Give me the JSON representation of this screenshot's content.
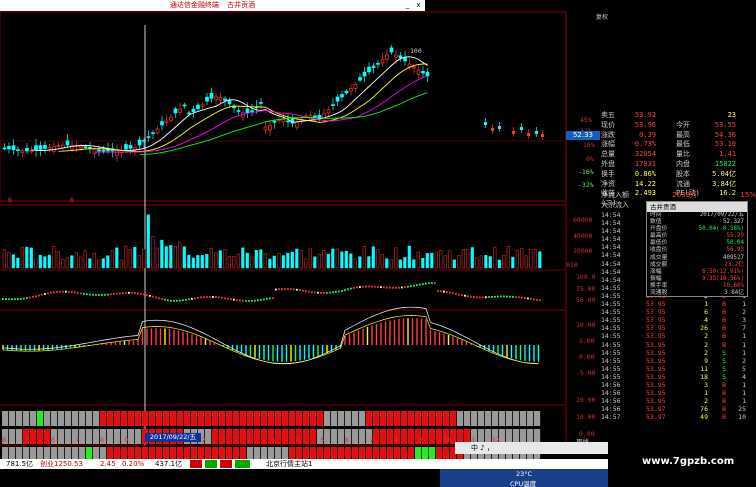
{
  "window": {
    "title_app": "通达信金融终端",
    "title_stock": "古井贡酒",
    "btn_min": "_",
    "btn_close": "x"
  },
  "tabs": {
    "label": " 复权"
  },
  "price_axis": {
    "labels": [
      "100",
      "45%",
      "32%",
      "16%",
      "0%",
      "-16%",
      "-32%"
    ],
    "price_tag": "52.33",
    "marks": [
      "B",
      "B"
    ]
  },
  "volume_axis": {
    "labels": [
      "60000",
      "40000",
      "20000",
      "X10"
    ]
  },
  "ind1_axis": {
    "labels": [
      "100.0",
      "75.00",
      "50.00"
    ]
  },
  "ind2_axis": {
    "labels": [
      "10.00",
      "5.00",
      "0.00",
      "-5.00"
    ]
  },
  "strip_axis": {
    "labels": [
      "20.00",
      "10.00",
      "0.00"
    ]
  },
  "date_axis": {
    "labels": [
      "8",
      "5",
      "6",
      "7",
      "8",
      "9",
      "10",
      "11",
      "12",
      "1",
      "2",
      "3",
      "4",
      "5",
      "6",
      "7",
      "8",
      "9",
      "10",
      "11",
      "12"
    ],
    "selected": "2017/09/22/五",
    "right_label": "周线"
  },
  "quote": {
    "header": "卖五",
    "rows": [
      [
        "现价",
        "53.96",
        "今开",
        "53.55"
      ],
      [
        "涨跌",
        "0.39",
        "最高",
        "54.36"
      ],
      [
        "涨幅",
        "0.73%",
        "最低",
        "53.10"
      ],
      [
        "总量",
        "32054",
        "量比",
        "1.41"
      ],
      [
        "外盘",
        "17831",
        "内盘",
        "15022"
      ],
      [
        "换手",
        "0.86%",
        "股本",
        "5.04亿"
      ],
      [
        "净资",
        "14.22",
        "流通",
        "3.84亿"
      ],
      [
        "收益(二)",
        "2.493",
        "PE(动)",
        "16.2"
      ]
    ],
    "sell5": {
      "price": "53.92",
      "vol": "23"
    }
  },
  "flow": {
    "label1": "净流入额",
    "value1": "2639万",
    "pct1": "15%",
    "label2": "大宗流入"
  },
  "ticks": [
    {
      "t": "14:54",
      "p": "53.95",
      "v": "1",
      "d": "B",
      "n": "2"
    },
    {
      "t": "14:54",
      "p": "53.95",
      "v": "4",
      "d": "B",
      "n": "1"
    },
    {
      "t": "14:54",
      "p": "53.95",
      "v": "1",
      "d": "B",
      "n": "1"
    },
    {
      "t": "14:54",
      "p": "53.95",
      "v": "1",
      "d": "B",
      "n": "1"
    },
    {
      "t": "14:54",
      "p": "53.95",
      "v": "2",
      "d": "B",
      "n": "1"
    },
    {
      "t": "14:54",
      "p": "53.95",
      "v": "1",
      "d": "B",
      "n": "1"
    },
    {
      "t": "14:54",
      "p": "53.95",
      "v": "2",
      "d": "B",
      "n": "1"
    },
    {
      "t": "14:54",
      "p": "53.95",
      "v": "1",
      "d": "B",
      "n": "1"
    },
    {
      "t": "14:54",
      "p": "53.95",
      "v": "3",
      "d": "B",
      "n": "1"
    },
    {
      "t": "14:55",
      "p": "53.95",
      "v": "1",
      "d": "B",
      "n": "1"
    },
    {
      "t": "14:55",
      "p": "53.95",
      "v": "2",
      "d": "B",
      "n": "1"
    },
    {
      "t": "14:55",
      "p": "53.95",
      "v": "1",
      "d": "B",
      "n": "1"
    },
    {
      "t": "14:55",
      "p": "53.95",
      "v": "6",
      "d": "B",
      "n": "2"
    },
    {
      "t": "14:55",
      "p": "53.95",
      "v": "4",
      "d": "B",
      "n": "3"
    },
    {
      "t": "14:55",
      "p": "53.95",
      "v": "26",
      "d": "B",
      "n": "7"
    },
    {
      "t": "14:55",
      "p": "53.95",
      "v": "2",
      "d": "B",
      "n": "1"
    },
    {
      "t": "14:55",
      "p": "53.95",
      "v": "2",
      "d": "B",
      "n": "1"
    },
    {
      "t": "14:55",
      "p": "53.95",
      "v": "2",
      "d": "S",
      "n": "1"
    },
    {
      "t": "14:55",
      "p": "53.95",
      "v": "9",
      "d": "S",
      "n": "2"
    },
    {
      "t": "14:55",
      "p": "53.95",
      "v": "11",
      "d": "S",
      "n": "5"
    },
    {
      "t": "14:55",
      "p": "53.95",
      "v": "18",
      "d": "S",
      "n": "4"
    },
    {
      "t": "14:56",
      "p": "53.95",
      "v": "3",
      "d": "B",
      "n": "1"
    },
    {
      "t": "14:56",
      "p": "53.95",
      "v": "1",
      "d": "B",
      "n": "1"
    },
    {
      "t": "14:56",
      "p": "53.95",
      "v": "2",
      "d": "B",
      "n": "1"
    },
    {
      "t": "14:56",
      "p": "53.97",
      "v": "76",
      "d": "B",
      "n": "25"
    },
    {
      "t": "14:57",
      "p": "53.97",
      "v": "49",
      "d": "B",
      "n": "10"
    }
  ],
  "popup": {
    "title": "古井贡酒",
    "rows": [
      [
        "时间",
        "2017/09/22/五"
      ],
      [
        "数值",
        "52.327"
      ],
      [
        "开盘价",
        "50.04(-0.58%)"
      ],
      [
        "最高价",
        "55.29"
      ],
      [
        "最低价",
        "50.04"
      ],
      [
        "收盘价",
        "56.93"
      ],
      [
        "成交量",
        "409527"
      ],
      [
        "成交额",
        "23.2亿"
      ],
      [
        "涨幅",
        "6.50(12.91%)"
      ],
      [
        "振幅",
        "9.35(18.56%)"
      ],
      [
        "换手率",
        "10.66%"
      ],
      [
        "流通股",
        "3.84亿"
      ]
    ]
  },
  "statusbar": {
    "item1": "781.5亿",
    "item2": "创业1250.53",
    "item3": "2.45",
    "item4": "0.20%",
    "item5": "437.1亿",
    "item6": "北京行情主站1"
  },
  "taskbar": {
    "label": "中 ♪ ，"
  },
  "tray": {
    "temp": "23°C",
    "cpu": "CPU温度"
  },
  "watermark": "www.7gpzb.com",
  "colors": {
    "up": "#ff3030",
    "down": "#00ffff",
    "ma1": "#ffffff",
    "ma2": "#ffff00",
    "ma3": "#ff00ff",
    "ma4": "#00ff00",
    "axis": "#c00000"
  }
}
